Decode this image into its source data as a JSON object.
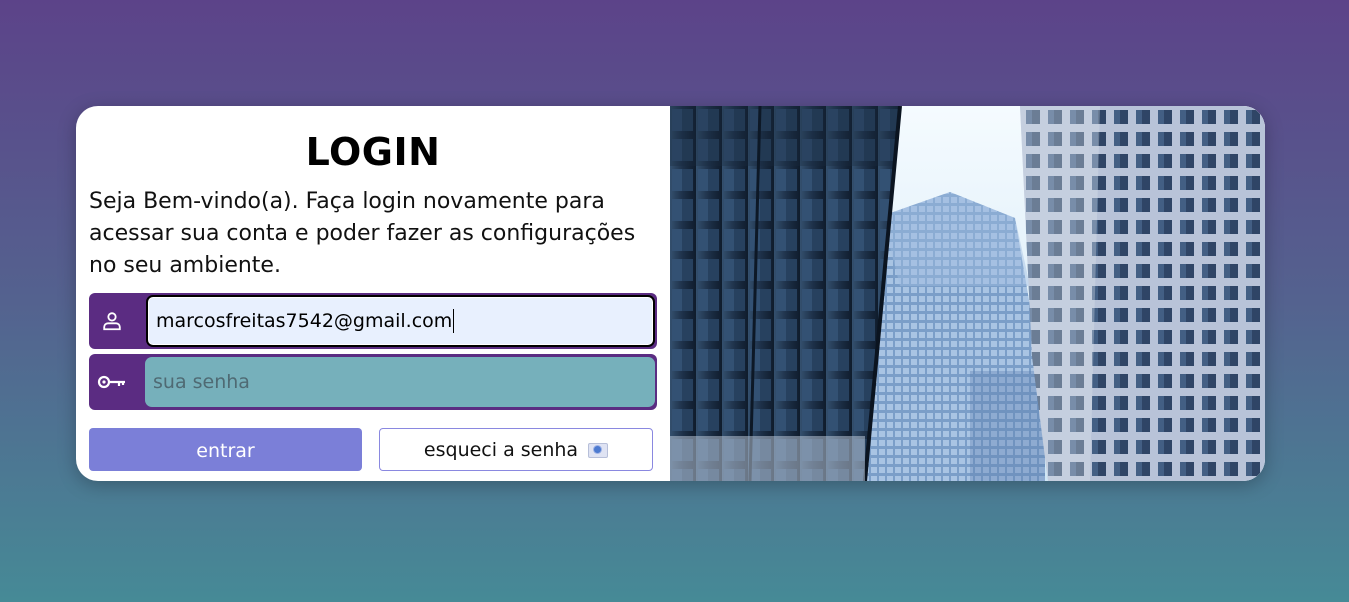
{
  "login": {
    "title": "LOGIN",
    "subtitle": "Seja Bem-vindo(a). Faça login novamente para acessar sua conta e poder fazer as configurações no seu ambiente.",
    "email_value": "marcosfreitas7542@gmail.com",
    "password_placeholder": "sua senha",
    "enter_label": "entrar",
    "forgot_label": "esqueci a senha"
  },
  "icons": {
    "user": "user-icon",
    "key": "key-icon",
    "forgot_emoji": "id-card-icon"
  },
  "image": {
    "description_name": "office-buildings-photo"
  },
  "colors": {
    "accent": "#5b2c82",
    "enter_button": "#7b7fd8",
    "password_field": "#76b0bb",
    "email_field": "#e8f0fe"
  }
}
